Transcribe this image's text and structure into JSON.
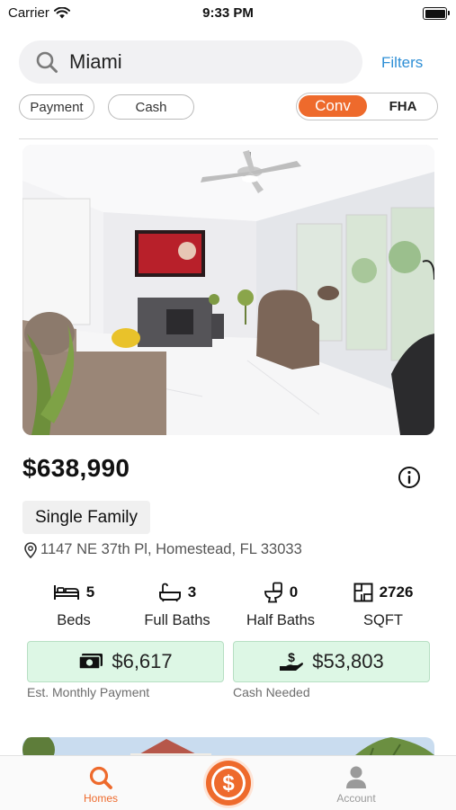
{
  "status_bar": {
    "carrier": "Carrier",
    "time": "9:33 PM"
  },
  "search": {
    "value": "Miami",
    "placeholder": "Search",
    "filters_label": "Filters"
  },
  "chips": {
    "payment": "Payment",
    "cash": "Cash"
  },
  "loan_toggle": {
    "options": [
      "Conv",
      "FHA"
    ],
    "selected": "Conv"
  },
  "listing": {
    "price": "$638,990",
    "property_type": "Single Family",
    "address": "1147 NE 37th Pl, Homestead, FL 33033",
    "stats": [
      {
        "icon": "bed-icon",
        "value": "5",
        "label": "Beds"
      },
      {
        "icon": "bathtub-icon",
        "value": "3",
        "label": "Full Baths"
      },
      {
        "icon": "toilet-icon",
        "value": "0",
        "label": "Half Baths"
      },
      {
        "icon": "floorplan-icon",
        "value": "2726",
        "label": "SQFT"
      }
    ],
    "monthly_payment": {
      "value": "$6,617",
      "label": "Est. Monthly Payment",
      "icon": "cash-icon"
    },
    "cash_needed": {
      "value": "$53,803",
      "label": "Cash Needed",
      "icon": "hand-dollar-icon"
    }
  },
  "tabs": [
    {
      "label": "Homes",
      "icon": "search-icon",
      "active": true
    },
    {
      "label": "",
      "icon": "dollar-icon",
      "active": false
    },
    {
      "label": "Account",
      "icon": "person-icon",
      "active": false
    }
  ],
  "colors": {
    "accent": "#ee6a2c",
    "link": "#2f8fd6",
    "money_bg": "#ddf7e5"
  }
}
